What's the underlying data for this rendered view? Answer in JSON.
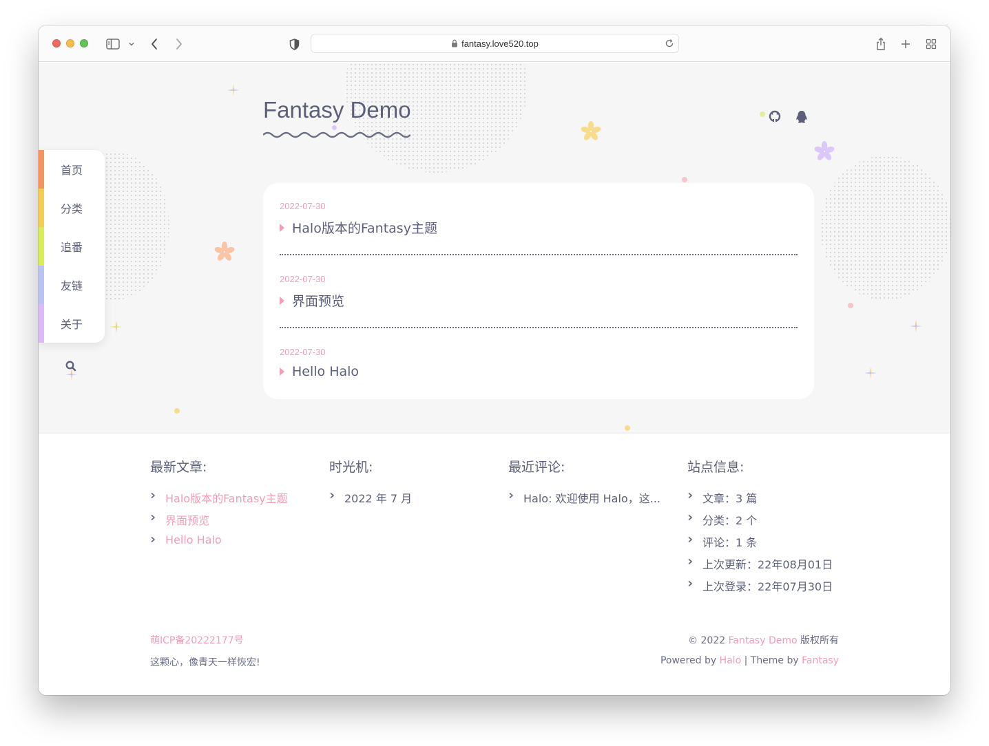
{
  "browser": {
    "url": "fantasy.love520.top",
    "icons": [
      "sidebar-icon",
      "chevron-down-icon",
      "back-icon",
      "forward-icon",
      "shield-icon",
      "lock-icon",
      "reload-icon",
      "share-icon",
      "new-tab-icon",
      "tab-overview-icon"
    ]
  },
  "site": {
    "title": "Fantasy Demo",
    "social_icons": [
      "github-icon",
      "qq-icon"
    ]
  },
  "nav": {
    "items": [
      {
        "label": "首页",
        "color": "#f5945c"
      },
      {
        "label": "分类",
        "color": "#f7cd4c"
      },
      {
        "label": "追番",
        "color": "#d8ee52"
      },
      {
        "label": "友链",
        "color": "#b9c4f5"
      },
      {
        "label": "关于",
        "color": "#dcbaf7"
      }
    ],
    "search_icon": "search-icon"
  },
  "posts": [
    {
      "date": "2022-07-30",
      "title": "Halo版本的Fantasy主题"
    },
    {
      "date": "2022-07-30",
      "title": "界面预览"
    },
    {
      "date": "2022-07-30",
      "title": "Hello Halo"
    }
  ],
  "footer": {
    "latest": {
      "heading": "最新文章:",
      "items": [
        "Halo版本的Fantasy主题",
        "界面预览",
        "Hello Halo"
      ]
    },
    "archive": {
      "heading": "时光机:",
      "items": [
        "2022 年 7 月"
      ]
    },
    "comments": {
      "heading": "最近评论:",
      "items": [
        "Halo: 欢迎使用 Halo，这..."
      ]
    },
    "info": {
      "heading": "站点信息:",
      "items": [
        "文章：3 篇",
        "分类：2 个",
        "评论：1 条",
        "上次更新：22年08月01日",
        "上次登录：22年07月30日"
      ]
    },
    "icp": "萌ICP备20222177号",
    "motto": "这颗心，像青天一样恢宏!",
    "copyright_prefix": "© 2022",
    "copyright_site": "Fantasy Demo",
    "copyright_suffix": "版权所有",
    "powered_prefix": "Powered by",
    "powered_halo": "Halo",
    "theme_prefix": "| Theme by",
    "theme_name": "Fantasy"
  },
  "colors": {
    "accent_pink": "#f59cb5",
    "text": "#5c5f7a",
    "hero_bg": "#f6f6f6"
  }
}
